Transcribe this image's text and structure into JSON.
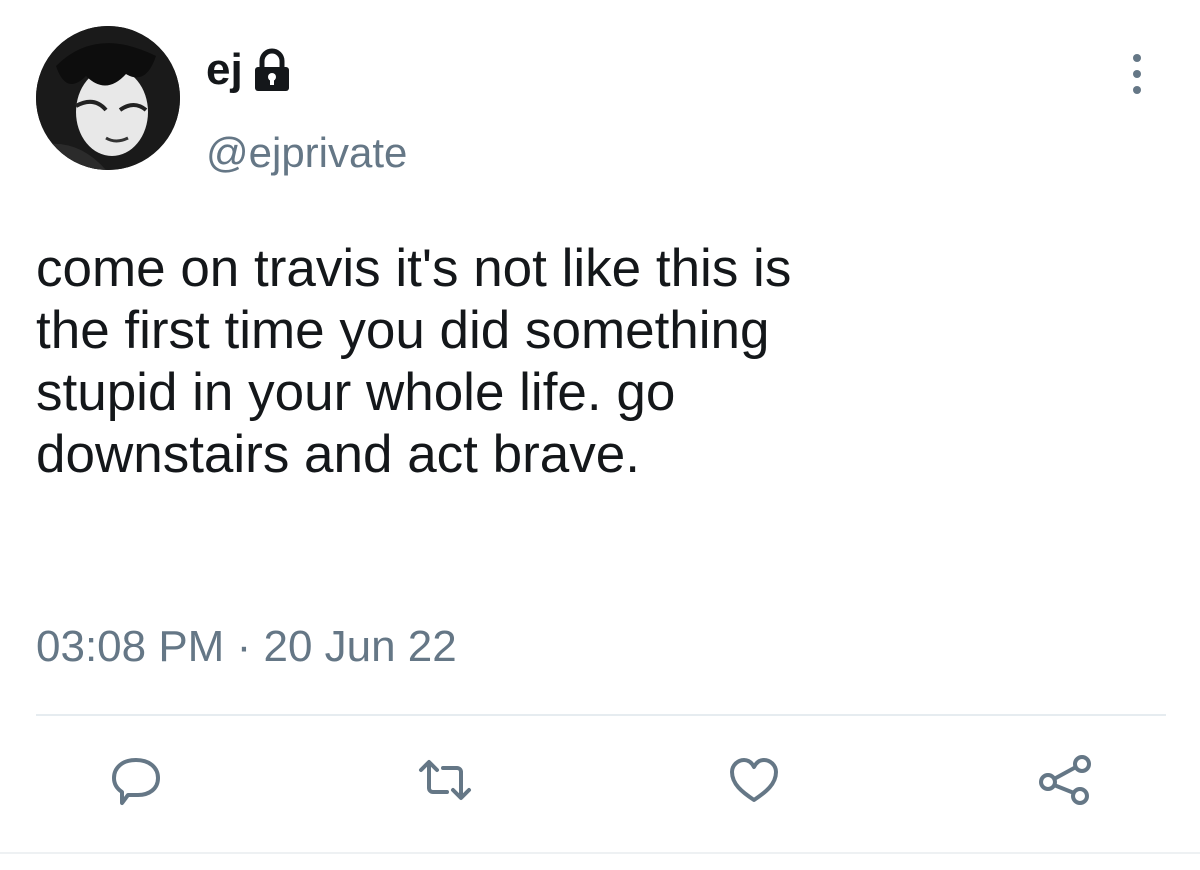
{
  "tweet": {
    "display_name": "ej",
    "handle": "@ejprivate",
    "text": "come on travis it's not like this is\nthe first time you did something\nstupid in your whole life. go\ndownstairs and act brave.",
    "time": "03:08 PM",
    "separator": "·",
    "date": "20 Jun 22"
  },
  "icons": {
    "protected": "lock-icon",
    "menu": "more-vertical-icon",
    "reply": "reply-icon",
    "retweet": "retweet-icon",
    "like": "like-icon",
    "share": "share-icon"
  },
  "colors": {
    "text": "#14171a",
    "secondary": "#657786",
    "divider": "#e6ecf0",
    "icon": "#657786"
  }
}
